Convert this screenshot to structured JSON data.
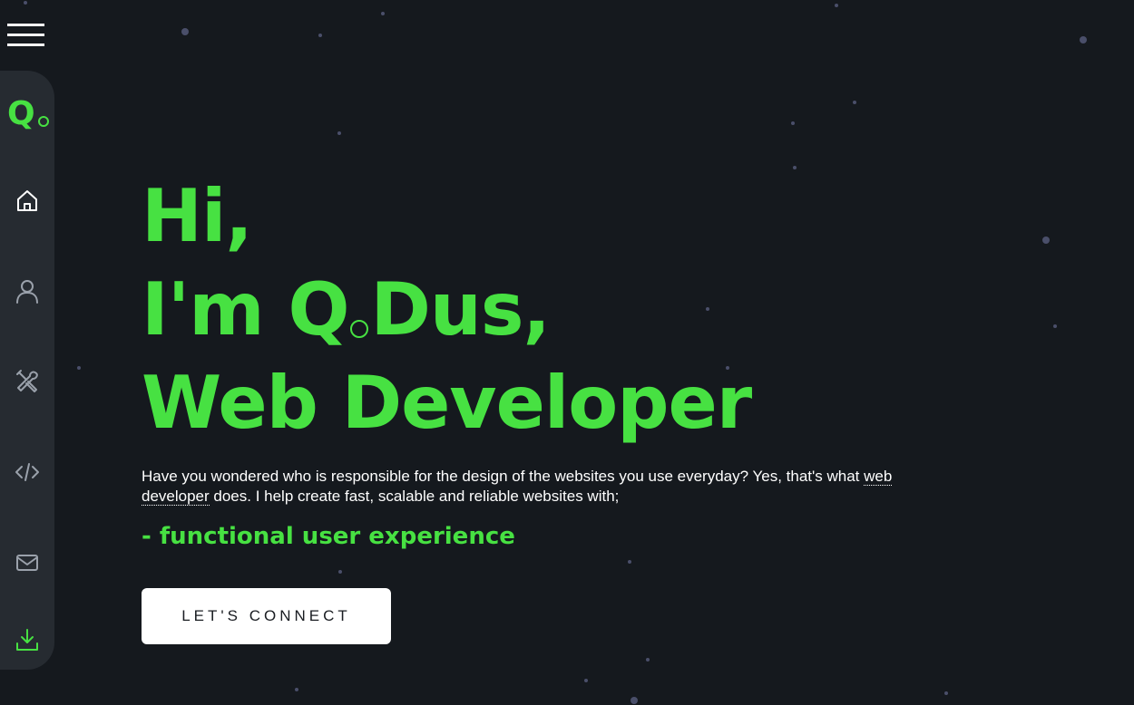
{
  "nav": {
    "menu_icon": "hamburger-menu-icon",
    "logo_letter": "Q",
    "items": [
      {
        "icon": "home-icon"
      },
      {
        "icon": "user-icon"
      },
      {
        "icon": "tools-icon"
      },
      {
        "icon": "code-icon"
      },
      {
        "icon": "mail-icon"
      },
      {
        "icon": "download-icon"
      }
    ]
  },
  "hero": {
    "line1": "Hi,",
    "line2_prefix": "I'm Q",
    "line2_suffix": "Dus,",
    "line3": "Web Developer",
    "intro_text_before": "Have you wondered who is responsible for the design of the websites you use everyday? Yes, that's what ",
    "intro_link": "web developer",
    "intro_text_after": " does. I help create fast, scalable and reliable websites with;",
    "feature": "- functional user experience",
    "cta_label": "LET'S CONNECT"
  },
  "colors": {
    "accent": "#47e142",
    "background": "#15191e",
    "sidebar": "#262b31",
    "text": "#ffffff",
    "button_bg": "#ffffff",
    "button_text": "#1a1d22"
  }
}
